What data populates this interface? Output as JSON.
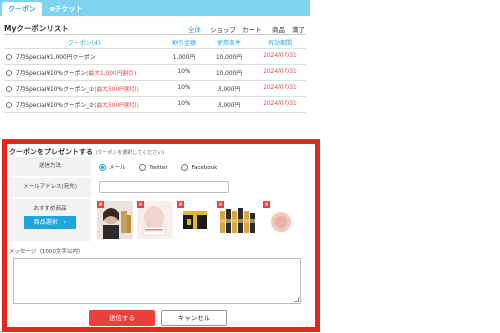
{
  "tabs": [
    {
      "label": "クーポン"
    },
    {
      "label": "eチケット"
    }
  ],
  "page_title": "Myクーポンリスト",
  "filters": [
    "全体",
    "ショップ",
    "カート",
    "商品",
    "満了"
  ],
  "table": {
    "headers": [
      "クーポン(4)",
      "割引金額",
      "使用条件",
      "有効期間"
    ],
    "rows": [
      {
        "name": "7月Special¥1,000円クーポン",
        "name_note": "",
        "discount": "1,000円",
        "condition": "10,000円",
        "expiry": "2024/07/31"
      },
      {
        "name": "7月Special¥10%クーポン",
        "name_note": "(最大1,000円割引)",
        "discount": "10%",
        "condition": "10,000円",
        "expiry": "2024/07/31"
      },
      {
        "name": "7月Special¥10%クーポン_①",
        "name_note": "(最大500円割引)",
        "discount": "10%",
        "condition": "3,000円",
        "expiry": "2024/07/31"
      },
      {
        "name": "7月Special¥10%クーポン_②",
        "name_note": "(最大500円割引)",
        "discount": "10%",
        "condition": "3,000円",
        "expiry": "2024/07/31"
      }
    ]
  },
  "gift": {
    "title": "クーポンをプレゼントする",
    "title_note": "(クーポンを選択してください)",
    "method_label": "送信方法",
    "methods": [
      "メール",
      "Twitter",
      "Facebook"
    ],
    "selected_method": "メール",
    "email_label": "メールアドレス(宛先)",
    "email_value": "",
    "recommend_label": "おすすめ商品",
    "select_button": "商品選択　›",
    "message_label": "メッセージ（1000文字以内）",
    "message_value": "",
    "send_button": "送信する",
    "cancel_button": "キャンセル"
  },
  "colors": {
    "accent": "#1fa5de",
    "alert": "#e8413c",
    "highlight_border": "#e8241f",
    "tabbar": "#7fd3f0"
  }
}
